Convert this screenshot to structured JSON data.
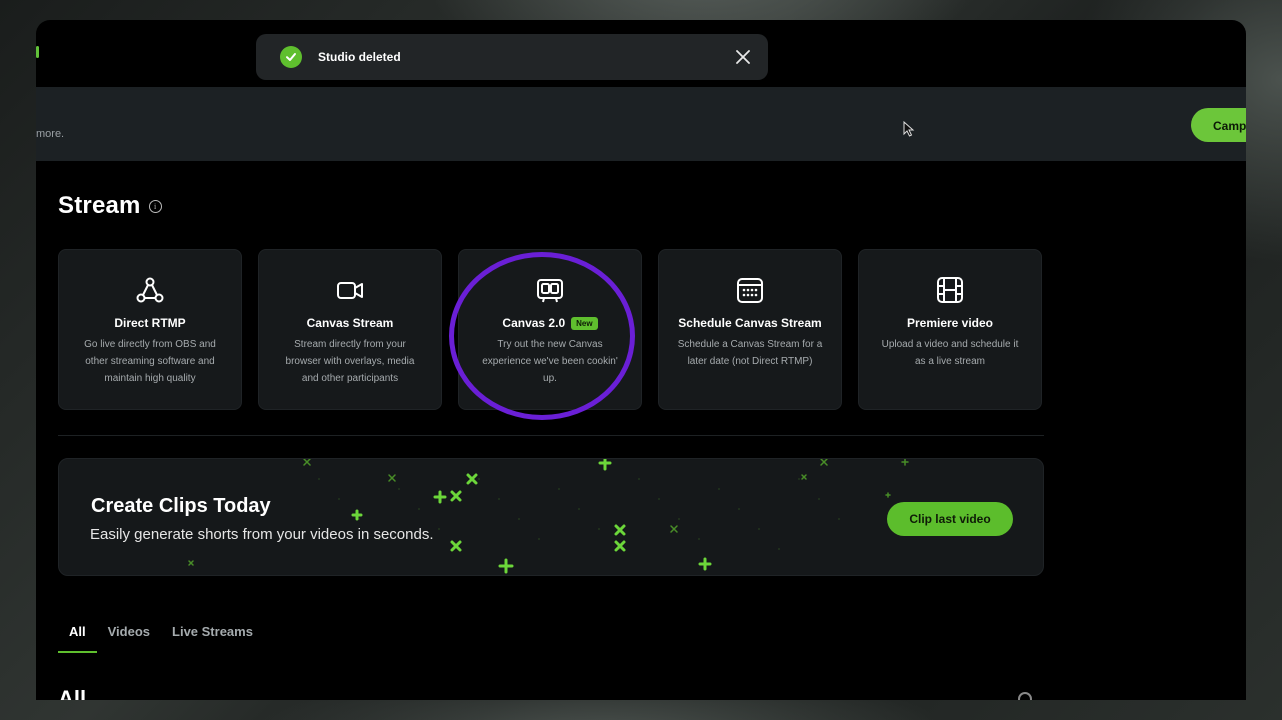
{
  "toast": {
    "message": "Studio deleted"
  },
  "banner": {
    "trailing_text": "more.",
    "button_label": "Camp"
  },
  "stream": {
    "title": "Stream",
    "cards": [
      {
        "icon": "rtmp-nodes-icon",
        "title": "Direct RTMP",
        "description": "Go live directly from OBS and other streaming software and maintain high quality"
      },
      {
        "icon": "video-camera-icon",
        "title": "Canvas Stream",
        "description": "Stream directly from your browser with overlays, media and other participants"
      },
      {
        "icon": "tv-icon",
        "title": "Canvas 2.0",
        "badge": "New",
        "description": "Try out the new Canvas experience we've been cookin' up."
      },
      {
        "icon": "calendar-icon",
        "title": "Schedule Canvas Stream",
        "description": "Schedule a Canvas Stream for a later date (not Direct RTMP)"
      },
      {
        "icon": "film-icon",
        "title": "Premiere video",
        "description": "Upload a video and schedule it as a live stream"
      }
    ]
  },
  "clips": {
    "title": "Create Clips Today",
    "subtitle": "Easily generate shorts from your videos in seconds.",
    "button_label": "Clip last video"
  },
  "tabs": [
    {
      "label": "All",
      "active": true
    },
    {
      "label": "Videos",
      "active": false
    },
    {
      "label": "Live Streams",
      "active": false
    }
  ],
  "section_heading": "All",
  "colors": {
    "accent": "#5fbf2e",
    "highlight": "#6a1fd6",
    "card_bg": "#16191b"
  }
}
